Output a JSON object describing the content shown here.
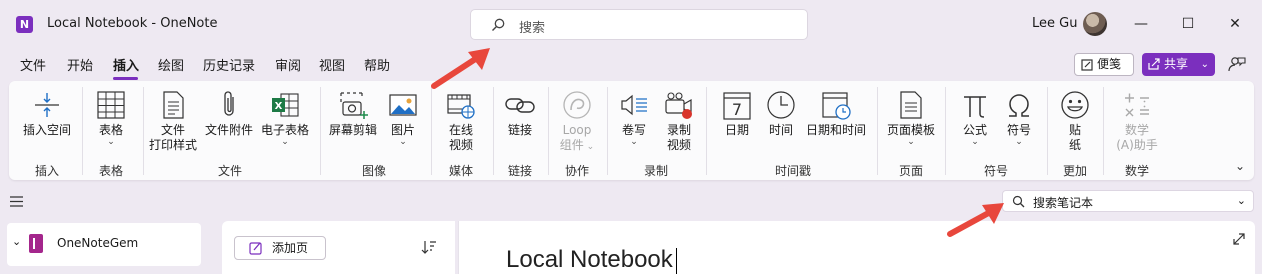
{
  "window": {
    "title": "Local Notebook  -  OneNote",
    "app_icon_letter": "N",
    "search_placeholder": "搜索",
    "user_name": "Lee Gu",
    "controls": {
      "minimize": "—",
      "maximize": "☐",
      "close": "✕"
    }
  },
  "menu": {
    "items": [
      "文件",
      "开始",
      "插入",
      "绘图",
      "历史记录",
      "审阅",
      "视图",
      "帮助"
    ],
    "active": "插入",
    "memo_label": "便笺",
    "share_label": "共享"
  },
  "ribbon": {
    "groups": [
      {
        "label": "插入",
        "buttons": [
          {
            "line1": "插入空间",
            "line2": ""
          }
        ]
      },
      {
        "label": "表格",
        "buttons": [
          {
            "line1": "表格",
            "line2": ""
          }
        ]
      },
      {
        "label": "文件",
        "buttons": [
          {
            "line1": "文件",
            "line2": "打印样式"
          },
          {
            "line1": "文件附件",
            "line2": ""
          },
          {
            "line1": "电子表格",
            "line2": ""
          }
        ]
      },
      {
        "label": "图像",
        "buttons": [
          {
            "line1": "屏幕剪辑",
            "line2": ""
          },
          {
            "line1": "图片",
            "line2": ""
          }
        ]
      },
      {
        "label": "媒体",
        "buttons": [
          {
            "line1": "在线",
            "line2": "视频"
          }
        ]
      },
      {
        "label": "链接",
        "buttons": [
          {
            "line1": "链接",
            "line2": ""
          }
        ]
      },
      {
        "label": "协作",
        "buttons": [
          {
            "line1": "Loop",
            "line2": "组件"
          }
        ]
      },
      {
        "label": "录制",
        "buttons": [
          {
            "line1": "卷写",
            "line2": ""
          },
          {
            "line1": "录制",
            "line2": "视频"
          }
        ]
      },
      {
        "label": "时间戳",
        "buttons": [
          {
            "line1": "日期",
            "line2": ""
          },
          {
            "line1": "时间",
            "line2": ""
          },
          {
            "line1": "日期和时间",
            "line2": ""
          }
        ]
      },
      {
        "label": "页面",
        "buttons": [
          {
            "line1": "页面模板",
            "line2": ""
          }
        ]
      },
      {
        "label": "符号",
        "buttons": [
          {
            "line1": "公式",
            "line2": ""
          },
          {
            "line1": "符号",
            "line2": ""
          }
        ]
      },
      {
        "label": "更加",
        "buttons": [
          {
            "line1": "贴",
            "line2": "纸"
          }
        ]
      },
      {
        "label": "数学",
        "buttons": [
          {
            "line1": "数学",
            "line2": "(A)助手"
          }
        ]
      }
    ],
    "calendar_day": "7"
  },
  "notebook_search": {
    "placeholder": "搜索笔记本"
  },
  "notebook": {
    "name": "OneNoteGem"
  },
  "pages": {
    "add_label": "添加页"
  },
  "canvas": {
    "page_title": "Local Notebook"
  },
  "colors": {
    "accent": "#7b2fbe",
    "arrow": "#e8473c",
    "notebook": "#a4268c"
  }
}
